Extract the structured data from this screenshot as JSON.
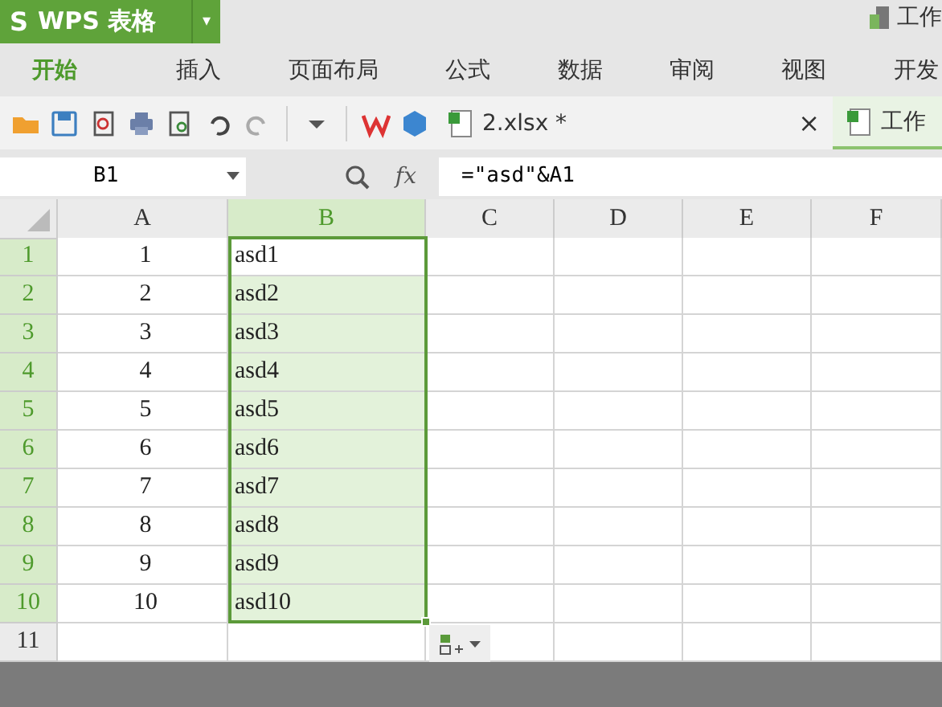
{
  "app_button": {
    "logo": "S",
    "label": "WPS 表格",
    "caret": "▾"
  },
  "workspace_tab": {
    "label": "工作"
  },
  "ribbon_tabs": [
    {
      "label": "开始",
      "selected": true
    },
    {
      "label": "插入",
      "selected": false
    },
    {
      "label": "页面布局",
      "selected": false
    },
    {
      "label": "公式",
      "selected": false
    },
    {
      "label": "数据",
      "selected": false
    },
    {
      "label": "审阅",
      "selected": false
    },
    {
      "label": "视图",
      "selected": false
    },
    {
      "label": "开发",
      "selected": false
    }
  ],
  "document_tabs": [
    {
      "label": "2.xlsx *",
      "close": "×",
      "selected": true
    },
    {
      "label": "工作",
      "selected": false
    }
  ],
  "formula_bar": {
    "name_box": "B1",
    "fx": "fx",
    "formula": "=\"asd\"&A1"
  },
  "sheet": {
    "columns": [
      {
        "label": "A",
        "selected": false
      },
      {
        "label": "B",
        "selected": true
      },
      {
        "label": "C",
        "selected": false
      },
      {
        "label": "D",
        "selected": false
      },
      {
        "label": "E",
        "selected": false
      },
      {
        "label": "F",
        "selected": false
      }
    ],
    "rows": [
      {
        "header": "1",
        "a": "1",
        "b": "asd1",
        "selected": true
      },
      {
        "header": "2",
        "a": "2",
        "b": "asd2",
        "selected": true
      },
      {
        "header": "3",
        "a": "3",
        "b": "asd3",
        "selected": true
      },
      {
        "header": "4",
        "a": "4",
        "b": "asd4",
        "selected": true
      },
      {
        "header": "5",
        "a": "5",
        "b": "asd5",
        "selected": true
      },
      {
        "header": "6",
        "a": "6",
        "b": "asd6",
        "selected": true
      },
      {
        "header": "7",
        "a": "7",
        "b": "asd7",
        "selected": true
      },
      {
        "header": "8",
        "a": "8",
        "b": "asd8",
        "selected": true
      },
      {
        "header": "9",
        "a": "9",
        "b": "asd9",
        "selected": true
      },
      {
        "header": "10",
        "a": "10",
        "b": "asd10",
        "selected": true
      },
      {
        "header": "11",
        "selected": false
      }
    ]
  }
}
